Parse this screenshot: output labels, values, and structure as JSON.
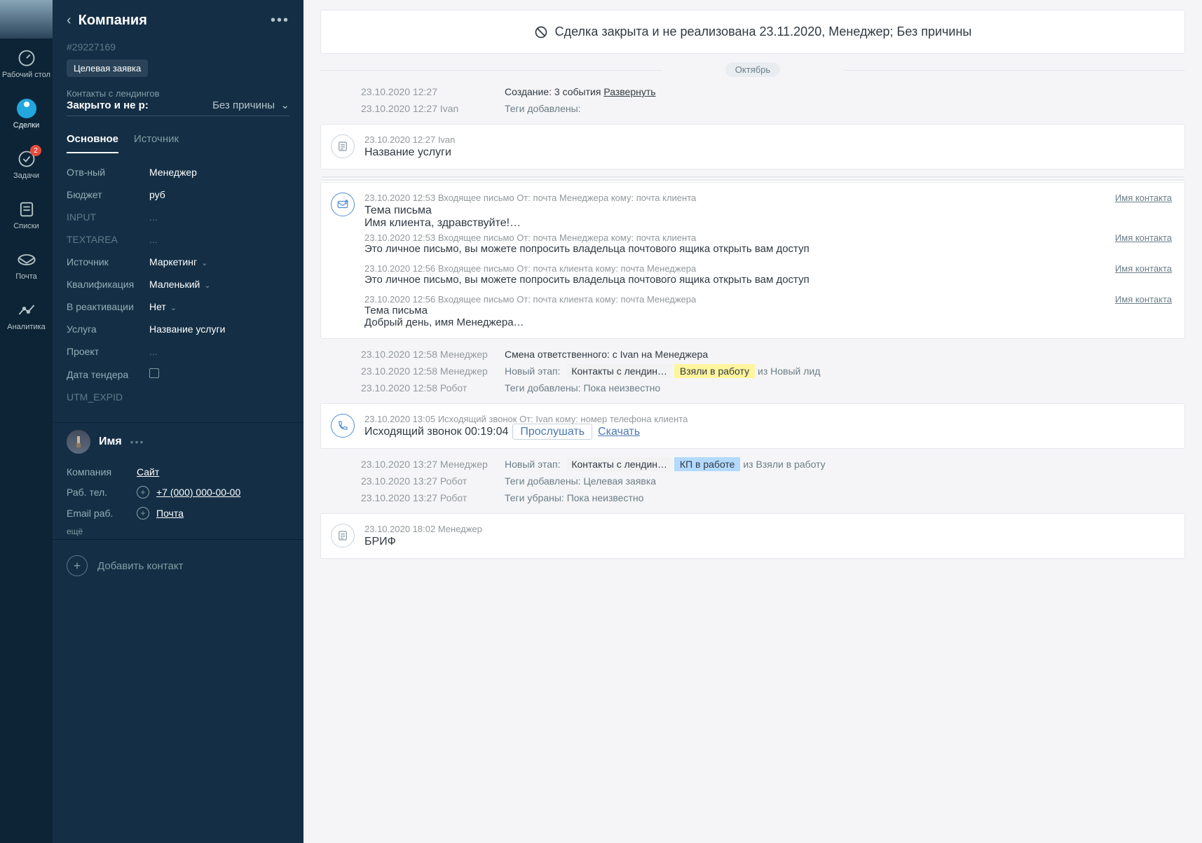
{
  "rail": {
    "items": [
      {
        "label": "Рабочий стол"
      },
      {
        "label": "Сделки"
      },
      {
        "label": "Задачи",
        "badge": "2"
      },
      {
        "label": "Списки"
      },
      {
        "label": "Почта"
      },
      {
        "label": "Аналитика"
      }
    ]
  },
  "side": {
    "title": "Компания",
    "deal_id": "#29227169",
    "tag": "Целевая заявка",
    "pipeline_label": "Контакты с лендингов",
    "status_left": "Закрыто и не р:",
    "status_right": "Без причины",
    "tabs": {
      "main": "Основное",
      "source": "Источник"
    },
    "fields": [
      {
        "label": "Отв-ный",
        "value": "Менеджер"
      },
      {
        "label": "Бюджет",
        "value": "руб"
      },
      {
        "label": "INPUT",
        "value": "...",
        "placeholder_label": true
      },
      {
        "label": "TEXTAREA",
        "value": "...",
        "placeholder_label": true
      },
      {
        "label": "Источник",
        "value": "Маркетинг",
        "chevron": true
      },
      {
        "label": "Квалификация",
        "value": "Маленький",
        "chevron": true
      },
      {
        "label": "В реактивации",
        "value": "Нет",
        "chevron": true
      },
      {
        "label": "Услуга",
        "value": "Название услуги"
      },
      {
        "label": "Проект",
        "value": "..."
      },
      {
        "label": "Дата тендера",
        "value": "",
        "calendar": true
      },
      {
        "label": "UTM_EXPID",
        "value": "",
        "placeholder_label": true
      }
    ],
    "contact": {
      "name": "Имя",
      "rows": [
        {
          "label": "Компания",
          "value": "Сайт"
        },
        {
          "label": "Раб. тел.",
          "value": "+7 (000) 000-00-00",
          "plus": true
        },
        {
          "label": "Email раб.",
          "value": "Почта",
          "plus": true
        }
      ],
      "more": "ещё"
    },
    "add_contact": "Добавить контакт"
  },
  "banner": "Сделка закрыта и не реализована 23.11.2020, Менеджер; Без причины",
  "month": "Октябрь",
  "timeline": {
    "row1": {
      "ts": "23.10.2020 12:27",
      "text": "Создание: 3 события ",
      "link": "Развернуть"
    },
    "row2": {
      "ts": "23.10.2020 12:27 Ivan",
      "label": "Теги добавлены:"
    },
    "card_note": {
      "ts": "23.10.2020 12:27 Ivan",
      "title": "Название услуги"
    },
    "card_mail": {
      "head_meta": "23.10.2020 12:53 Входящее письмо От: почта Менеджера  кому: почта клиента",
      "head_contact": "Имя контакта",
      "subject": "Тема письма",
      "preview": "Имя клиента, здравствуйте!…",
      "subs": [
        {
          "meta": "23.10.2020 12:53 Входящее письмо От: почта Менеджера  кому: почта клиента",
          "text": "Это личное письмо, вы можете попросить владельца почтового ящика открыть вам доступ",
          "contact": "Имя контакта"
        },
        {
          "meta": "23.10.2020 12:56 Входящее письмо От: почта клиента      кому: почта Менеджера",
          "text": "Это личное письмо, вы можете попросить владельца почтового ящика открыть вам доступ",
          "contact": "Имя контакта"
        },
        {
          "meta": "23.10.2020 12:56 Входящее письмо От: почта клиента      кому: почта Менеджера",
          "subject": "Тема письма",
          "text": "Добрый день, имя Менеджера…",
          "contact": "Имя контакта"
        }
      ]
    },
    "row_resp": {
      "ts": "23.10.2020 12:58 Менеджер",
      "label": "Смена ответственного: с Ivan на Менеджера"
    },
    "row_stage1": {
      "ts": "23.10.2020 12:58 Менеджер",
      "label": "Новый этап:",
      "from": "Контакты с лендин…",
      "to": "Взяли в работу",
      "tail": "из Новый лид"
    },
    "row_tags1": {
      "ts": "23.10.2020 12:58 Робот",
      "label": "Теги добавлены: Пока неизвестно"
    },
    "card_call": {
      "meta": "23.10.2020 13:05 Исходящий звонок От: Ivan кому: номер телефона клиента",
      "title": "Исходящий звонок 00:19:04",
      "listen": "Прослушать",
      "download": "Скачать"
    },
    "row_stage2": {
      "ts": "23.10.2020 13:27 Менеджер",
      "label": "Новый этап:",
      "from": "Контакты с лендин…",
      "to": "КП в работе",
      "tail": "из Взяли в работу"
    },
    "row_tags2": {
      "ts": "23.10.2020 13:27 Робот",
      "label": "Теги добавлены: Целевая заявка"
    },
    "row_tags3": {
      "ts": "23.10.2020 13:27 Робот",
      "label": "Теги убраны: Пока неизвестно"
    },
    "card_brief": {
      "meta": "23.10.2020 18:02 Менеджер",
      "title": "БРИФ"
    }
  }
}
